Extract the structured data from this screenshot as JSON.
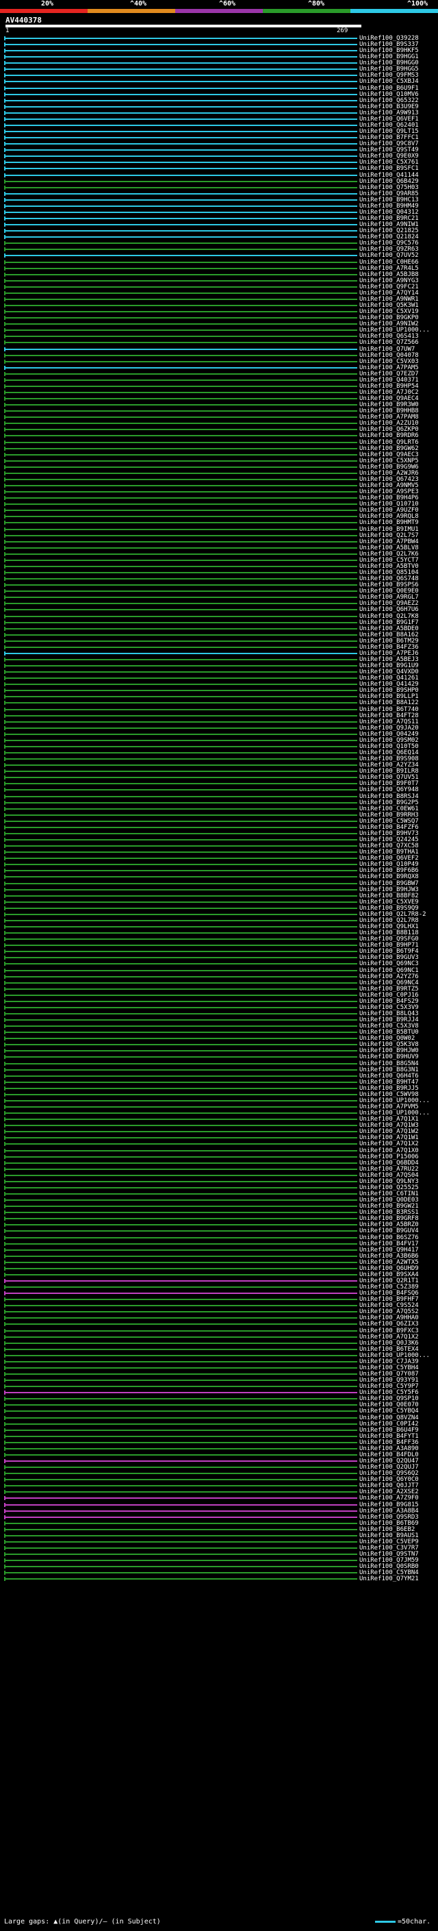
{
  "scale": {
    "labels": [
      "20%",
      "^40%",
      "^60%",
      "^80%",
      "^100%"
    ],
    "colors": [
      "#e52420",
      "#e08a1e",
      "#9a35a8",
      "#2a9b2a",
      "#2ec9e6"
    ]
  },
  "query": {
    "id": "AV440378",
    "start": "1",
    "end": "269"
  },
  "hit_colors": {
    "cyan": "#2ec9e6",
    "green": "#2a9b2a",
    "magenta": "#c040c0"
  },
  "hits": [
    {
      "id": "UniRef100_Q39228",
      "c": "cyan"
    },
    {
      "id": "UniRef100_B9S337",
      "c": "cyan"
    },
    {
      "id": "UniRef100_B9HKF5",
      "c": "cyan"
    },
    {
      "id": "UniRef100_B9HGG1",
      "c": "cyan"
    },
    {
      "id": "UniRef100_B9HGG0",
      "c": "cyan"
    },
    {
      "id": "UniRef100_B9HGG5",
      "c": "cyan"
    },
    {
      "id": "UniRef100_Q9FMS3",
      "c": "cyan"
    },
    {
      "id": "UniRef100_C5XBJ4",
      "c": "cyan"
    },
    {
      "id": "UniRef100_B6U9F1",
      "c": "cyan"
    },
    {
      "id": "UniRef100_Q10MV6",
      "c": "cyan"
    },
    {
      "id": "UniRef100_Q65322",
      "c": "cyan"
    },
    {
      "id": "UniRef100_B3U9E9",
      "c": "cyan"
    },
    {
      "id": "UniRef100_A9W913",
      "c": "cyan"
    },
    {
      "id": "UniRef100_Q6VEF1",
      "c": "cyan"
    },
    {
      "id": "UniRef100_Q62401",
      "c": "cyan"
    },
    {
      "id": "UniRef100_Q9LT15",
      "c": "cyan"
    },
    {
      "id": "UniRef100_B7FFC1",
      "c": "cyan"
    },
    {
      "id": "UniRef100_Q9C8V7",
      "c": "cyan"
    },
    {
      "id": "UniRef100_Q9ST49",
      "c": "cyan"
    },
    {
      "id": "UniRef100_Q9E0X9",
      "c": "cyan"
    },
    {
      "id": "UniRef100_C5X761",
      "c": "cyan"
    },
    {
      "id": "UniRef100_B9SFC1",
      "c": "cyan"
    },
    {
      "id": "UniRef100_Q41144",
      "c": "cyan"
    },
    {
      "id": "UniRef100_Q6B429",
      "c": "green"
    },
    {
      "id": "UniRef100_Q75H03",
      "c": "green"
    },
    {
      "id": "UniRef100_Q9AR85",
      "c": "cyan"
    },
    {
      "id": "UniRef100_B9HC13",
      "c": "cyan"
    },
    {
      "id": "UniRef100_B9HM49",
      "c": "cyan"
    },
    {
      "id": "UniRef100_Q04312",
      "c": "cyan"
    },
    {
      "id": "UniRef100_B9RC21",
      "c": "cyan"
    },
    {
      "id": "UniRef100_A9NIW1",
      "c": "cyan"
    },
    {
      "id": "UniRef100_Q21825",
      "c": "cyan"
    },
    {
      "id": "UniRef100_Q21824",
      "c": "cyan"
    },
    {
      "id": "UniRef100_Q9C576",
      "c": "green"
    },
    {
      "id": "UniRef100_Q9ZR63",
      "c": "green"
    },
    {
      "id": "UniRef100_Q7UV52",
      "c": "cyan"
    },
    {
      "id": "UniRef100_C0HE66",
      "c": "green"
    },
    {
      "id": "UniRef100_A7R4L5",
      "c": "green"
    },
    {
      "id": "UniRef100_A5BJB8",
      "c": "green"
    },
    {
      "id": "UniRef100_A9NYG3",
      "c": "green"
    },
    {
      "id": "UniRef100_Q9FC21",
      "c": "green"
    },
    {
      "id": "UniRef100_A7QY14",
      "c": "green"
    },
    {
      "id": "UniRef100_A9NWR1",
      "c": "green"
    },
    {
      "id": "UniRef100_Q5K3W1",
      "c": "green"
    },
    {
      "id": "UniRef100_C5XV19",
      "c": "green"
    },
    {
      "id": "UniRef100_B9GKP0",
      "c": "green"
    },
    {
      "id": "UniRef100_A9NIW2",
      "c": "green"
    },
    {
      "id": "UniRef100_UP1000...",
      "c": "green"
    },
    {
      "id": "UniRef100_Q6S413",
      "c": "green"
    },
    {
      "id": "UniRef100_Q7Z566",
      "c": "green"
    },
    {
      "id": "UniRef100_Q7UW7",
      "c": "cyan"
    },
    {
      "id": "UniRef100_Q04078",
      "c": "green"
    },
    {
      "id": "UniRef100_C5VX03",
      "c": "green"
    },
    {
      "id": "UniRef100_A7PAM5",
      "c": "cyan"
    },
    {
      "id": "UniRef100_Q7EZD7",
      "c": "green"
    },
    {
      "id": "UniRef100_Q40371",
      "c": "green"
    },
    {
      "id": "UniRef100_B9HP54",
      "c": "green"
    },
    {
      "id": "UniRef100_A7J0C2",
      "c": "green"
    },
    {
      "id": "UniRef100_Q9AEC4",
      "c": "green"
    },
    {
      "id": "UniRef100_B9R3W0",
      "c": "green"
    },
    {
      "id": "UniRef100_B9HHB8",
      "c": "green"
    },
    {
      "id": "UniRef100_A7PAM8",
      "c": "green"
    },
    {
      "id": "UniRef100_A2ZU10",
      "c": "green"
    },
    {
      "id": "UniRef100_Q6ZKP0",
      "c": "green"
    },
    {
      "id": "UniRef100_B9RDR6",
      "c": "green"
    },
    {
      "id": "UniRef100_Q9LRT6",
      "c": "green"
    },
    {
      "id": "UniRef100_B9GW62",
      "c": "green"
    },
    {
      "id": "UniRef100_Q9AEC3",
      "c": "green"
    },
    {
      "id": "UniRef100_C5XNP5",
      "c": "green"
    },
    {
      "id": "UniRef100_B9G9W6",
      "c": "green"
    },
    {
      "id": "UniRef100_A2WJR6",
      "c": "green"
    },
    {
      "id": "UniRef100_Q67423",
      "c": "green"
    },
    {
      "id": "UniRef100_A9NMV5",
      "c": "green"
    },
    {
      "id": "UniRef100_A9SPE3",
      "c": "green"
    },
    {
      "id": "UniRef100_B9H4P6",
      "c": "green"
    },
    {
      "id": "UniRef100_Q10710",
      "c": "green"
    },
    {
      "id": "UniRef100_A9UZF0",
      "c": "green"
    },
    {
      "id": "UniRef100_A9RQL8",
      "c": "green"
    },
    {
      "id": "UniRef100_B9HMT9",
      "c": "green"
    },
    {
      "id": "UniRef100_B9IMU1",
      "c": "green"
    },
    {
      "id": "UniRef100_Q2L7S7",
      "c": "green"
    },
    {
      "id": "UniRef100_A7PBW4",
      "c": "green"
    },
    {
      "id": "UniRef100_A5BLV8",
      "c": "green"
    },
    {
      "id": "UniRef100_Q2L7K6",
      "c": "green"
    },
    {
      "id": "UniRef100_C5YCT7",
      "c": "green"
    },
    {
      "id": "UniRef100_A5BTV0",
      "c": "green"
    },
    {
      "id": "UniRef100_Q85104",
      "c": "green"
    },
    {
      "id": "UniRef100_Q6S748",
      "c": "green"
    },
    {
      "id": "UniRef100_B9SPS6",
      "c": "green"
    },
    {
      "id": "UniRef100_Q0E9E0",
      "c": "green"
    },
    {
      "id": "UniRef100_A9RGL7",
      "c": "green"
    },
    {
      "id": "UniRef100_Q9AEZ2",
      "c": "green"
    },
    {
      "id": "UniRef100_Q6H7U6",
      "c": "green"
    },
    {
      "id": "UniRef100_Q2L7K8",
      "c": "green"
    },
    {
      "id": "UniRef100_B9G1F7",
      "c": "green"
    },
    {
      "id": "UniRef100_A5BDE0",
      "c": "green"
    },
    {
      "id": "UniRef100_B8A162",
      "c": "green"
    },
    {
      "id": "UniRef100_B6TM29",
      "c": "green"
    },
    {
      "id": "UniRef100_B4FZ36",
      "c": "green"
    },
    {
      "id": "UniRef100_A7PEJ6",
      "c": "cyan"
    },
    {
      "id": "UniRef100_A5BEJ3",
      "c": "green"
    },
    {
      "id": "UniRef100_B9G1U9",
      "c": "green"
    },
    {
      "id": "UniRef100_Q4VXD0",
      "c": "green"
    },
    {
      "id": "UniRef100_Q41261",
      "c": "green"
    },
    {
      "id": "UniRef100_Q41429",
      "c": "green"
    },
    {
      "id": "UniRef100_B9SHP0",
      "c": "green"
    },
    {
      "id": "UniRef100_B9LLP1",
      "c": "green"
    },
    {
      "id": "UniRef100_B8A122",
      "c": "green"
    },
    {
      "id": "UniRef100_B6T740",
      "c": "green"
    },
    {
      "id": "UniRef100_B4FT28",
      "c": "green"
    },
    {
      "id": "UniRef100_A7QS11",
      "c": "green"
    },
    {
      "id": "UniRef100_Q9JA20",
      "c": "green"
    },
    {
      "id": "UniRef100_Q04249",
      "c": "green"
    },
    {
      "id": "UniRef100_Q9SM02",
      "c": "green"
    },
    {
      "id": "UniRef100_Q10T50",
      "c": "green"
    },
    {
      "id": "UniRef100_Q6EQ14",
      "c": "green"
    },
    {
      "id": "UniRef100_B9S908",
      "c": "green"
    },
    {
      "id": "UniRef100_A2YZ34",
      "c": "green"
    },
    {
      "id": "UniRef100_B9ILR8",
      "c": "green"
    },
    {
      "id": "UniRef100_Q7UV51",
      "c": "green"
    },
    {
      "id": "UniRef100_B9F0T7",
      "c": "green"
    },
    {
      "id": "UniRef100_Q6Y948",
      "c": "green"
    },
    {
      "id": "UniRef100_B8RSJ4",
      "c": "green"
    },
    {
      "id": "UniRef100_B9G2P5",
      "c": "green"
    },
    {
      "id": "UniRef100_C0EW61",
      "c": "green"
    },
    {
      "id": "UniRef100_B9RRH3",
      "c": "green"
    },
    {
      "id": "UniRef100_C5WSQ7",
      "c": "green"
    },
    {
      "id": "UniRef100_B4FZF6",
      "c": "green"
    },
    {
      "id": "UniRef100_B9HV73",
      "c": "green"
    },
    {
      "id": "UniRef100_Q24245",
      "c": "green"
    },
    {
      "id": "UniRef100_Q7XC58",
      "c": "green"
    },
    {
      "id": "UniRef100_B9THA1",
      "c": "green"
    },
    {
      "id": "UniRef100_Q6VEF2",
      "c": "green"
    },
    {
      "id": "UniRef100_Q10P49",
      "c": "green"
    },
    {
      "id": "UniRef100_B9F6B6",
      "c": "green"
    },
    {
      "id": "UniRef100_B9RQX8",
      "c": "green"
    },
    {
      "id": "UniRef100_B9GBW7",
      "c": "green"
    },
    {
      "id": "UniRef100_B9HJW3",
      "c": "green"
    },
    {
      "id": "UniRef100_B8BF82",
      "c": "green"
    },
    {
      "id": "UniRef100_C5XVE9",
      "c": "green"
    },
    {
      "id": "UniRef100_B9S9Q9",
      "c": "green"
    },
    {
      "id": "UniRef100_Q2L7R8-2",
      "c": "green"
    },
    {
      "id": "UniRef100_Q2L7R8",
      "c": "green"
    },
    {
      "id": "UniRef100_Q9LHX1",
      "c": "green"
    },
    {
      "id": "UniRef100_B8B118",
      "c": "green"
    },
    {
      "id": "UniRef100_Q9SFG0",
      "c": "green"
    },
    {
      "id": "UniRef100_B9HP71",
      "c": "green"
    },
    {
      "id": "UniRef100_B6T9F4",
      "c": "green"
    },
    {
      "id": "UniRef100_B9GUV3",
      "c": "green"
    },
    {
      "id": "UniRef100_Q69NC3",
      "c": "green"
    },
    {
      "id": "UniRef100_Q69NC1",
      "c": "green"
    },
    {
      "id": "UniRef100_A2YZ76",
      "c": "green"
    },
    {
      "id": "UniRef100_Q69NC4",
      "c": "green"
    },
    {
      "id": "UniRef100_B9RTZ5",
      "c": "green"
    },
    {
      "id": "UniRef100_C0PJ16",
      "c": "green"
    },
    {
      "id": "UniRef100_B4FS29",
      "c": "green"
    },
    {
      "id": "UniRef100_C5X3V9",
      "c": "green"
    },
    {
      "id": "UniRef100_B8LQ43",
      "c": "green"
    },
    {
      "id": "UniRef100_B9RJJ4",
      "c": "green"
    },
    {
      "id": "UniRef100_C5X3V8",
      "c": "green"
    },
    {
      "id": "UniRef100_B5BTU0",
      "c": "green"
    },
    {
      "id": "UniRef100_Q0W02",
      "c": "green"
    },
    {
      "id": "UniRef100_Q5K3V8",
      "c": "green"
    },
    {
      "id": "UniRef100_B9HJW0",
      "c": "green"
    },
    {
      "id": "UniRef100_B9HUV9",
      "c": "green"
    },
    {
      "id": "UniRef100_B8G5N4",
      "c": "green"
    },
    {
      "id": "UniRef100_B8G3N1",
      "c": "green"
    },
    {
      "id": "UniRef100_Q6H4T6",
      "c": "green"
    },
    {
      "id": "UniRef100_B9HT47",
      "c": "green"
    },
    {
      "id": "UniRef100_B9RJJ5",
      "c": "green"
    },
    {
      "id": "UniRef100_C5WV98",
      "c": "green"
    },
    {
      "id": "UniRef100_UP1000...",
      "c": "green"
    },
    {
      "id": "UniRef100_A7PVM5",
      "c": "green"
    },
    {
      "id": "UniRef100_UP1000...",
      "c": "green"
    },
    {
      "id": "UniRef100_A7Q1X1",
      "c": "green"
    },
    {
      "id": "UniRef100_A7Q1W3",
      "c": "green"
    },
    {
      "id": "UniRef100_A7Q1W2",
      "c": "green"
    },
    {
      "id": "UniRef100_A7Q1W1",
      "c": "green"
    },
    {
      "id": "UniRef100_A7Q1X2",
      "c": "green"
    },
    {
      "id": "UniRef100_A7Q1X0",
      "c": "green"
    },
    {
      "id": "UniRef100_P15006",
      "c": "green"
    },
    {
      "id": "UniRef100_Q6BDD4",
      "c": "green"
    },
    {
      "id": "UniRef100_A7RU22",
      "c": "green"
    },
    {
      "id": "UniRef100_A7QS04",
      "c": "green"
    },
    {
      "id": "UniRef100_Q9LNY3",
      "c": "green"
    },
    {
      "id": "UniRef100_Q25525",
      "c": "green"
    },
    {
      "id": "UniRef100_C6TIN1",
      "c": "green"
    },
    {
      "id": "UniRef100_Q0DE03",
      "c": "green"
    },
    {
      "id": "UniRef100_B9GW21",
      "c": "green"
    },
    {
      "id": "UniRef100_B3RSS1",
      "c": "green"
    },
    {
      "id": "UniRef100_B9GRF8",
      "c": "green"
    },
    {
      "id": "UniRef100_A5BRZ0",
      "c": "green"
    },
    {
      "id": "UniRef100_B9GUV4",
      "c": "green"
    },
    {
      "id": "UniRef100_B6SZ76",
      "c": "green"
    },
    {
      "id": "UniRef100_B4FV17",
      "c": "green"
    },
    {
      "id": "UniRef100_Q9H417",
      "c": "green"
    },
    {
      "id": "UniRef100_A3B6B6",
      "c": "green"
    },
    {
      "id": "UniRef100_A2WTX5",
      "c": "green"
    },
    {
      "id": "UniRef100_Q6UHD9",
      "c": "green"
    },
    {
      "id": "UniRef100_B9SXA4",
      "c": "green"
    },
    {
      "id": "UniRef100_Q2R1T1",
      "c": "magenta"
    },
    {
      "id": "UniRef100_C5Z389",
      "c": "green"
    },
    {
      "id": "UniRef100_B4FSQ6",
      "c": "magenta"
    },
    {
      "id": "UniRef100_B9FHF7",
      "c": "green"
    },
    {
      "id": "UniRef100_C9S524",
      "c": "green"
    },
    {
      "id": "UniRef100_A7Q5S2",
      "c": "green"
    },
    {
      "id": "UniRef100_A9HHA0",
      "c": "green"
    },
    {
      "id": "UniRef100_Q6ZIX3",
      "c": "green"
    },
    {
      "id": "UniRef100_B9FXC3",
      "c": "green"
    },
    {
      "id": "UniRef100_A7Q1X2",
      "c": "green"
    },
    {
      "id": "UniRef100_Q0J3K6",
      "c": "green"
    },
    {
      "id": "UniRef100_B6TEX4",
      "c": "green"
    },
    {
      "id": "UniRef100_UP1000...",
      "c": "green"
    },
    {
      "id": "UniRef100_C7JA39",
      "c": "green"
    },
    {
      "id": "UniRef100_C5YBH4",
      "c": "green"
    },
    {
      "id": "UniRef100_Q7Y087",
      "c": "green"
    },
    {
      "id": "UniRef100_Q93Y91",
      "c": "green"
    },
    {
      "id": "UniRef100_C5Y9P7",
      "c": "green"
    },
    {
      "id": "UniRef100_C5Y5F6",
      "c": "magenta"
    },
    {
      "id": "UniRef100_Q9SP10",
      "c": "green"
    },
    {
      "id": "UniRef100_Q0E070",
      "c": "green"
    },
    {
      "id": "UniRef100_C5YBQ4",
      "c": "green"
    },
    {
      "id": "UniRef100_Q8VZN4",
      "c": "green"
    },
    {
      "id": "UniRef100_C0PI42",
      "c": "green"
    },
    {
      "id": "UniRef100_B6U4F9",
      "c": "green"
    },
    {
      "id": "UniRef100_B4FYT1",
      "c": "green"
    },
    {
      "id": "UniRef100_B4FF36",
      "c": "green"
    },
    {
      "id": "UniRef100_A3A890",
      "c": "green"
    },
    {
      "id": "UniRef100_B4FDL0",
      "c": "green"
    },
    {
      "id": "UniRef100_Q2QU47",
      "c": "magenta"
    },
    {
      "id": "UniRef100_Q2QUJ7",
      "c": "green"
    },
    {
      "id": "UniRef100_Q9S6Q2",
      "c": "green"
    },
    {
      "id": "UniRef100_Q6Y0C0",
      "c": "green"
    },
    {
      "id": "UniRef100_Q0JJT7",
      "c": "green"
    },
    {
      "id": "UniRef100_A2XSE2",
      "c": "green"
    },
    {
      "id": "UniRef100_A7Z9F0",
      "c": "magenta"
    },
    {
      "id": "UniRef100_B9G815",
      "c": "magenta"
    },
    {
      "id": "UniRef100_A3A8B4",
      "c": "magenta"
    },
    {
      "id": "UniRef100_Q9SRD3",
      "c": "magenta"
    },
    {
      "id": "UniRef100_B6TB69",
      "c": "green"
    },
    {
      "id": "UniRef100_B6EB2",
      "c": "green"
    },
    {
      "id": "UniRef100_B9AUS1",
      "c": "green"
    },
    {
      "id": "UniRef100_C5VEP9",
      "c": "green"
    },
    {
      "id": "UniRef100_C3V7R7",
      "c": "green"
    },
    {
      "id": "UniRef100_Q9STN7",
      "c": "green"
    },
    {
      "id": "UniRef100_Q7JM59",
      "c": "green"
    },
    {
      "id": "UniRef100_Q0SRB0",
      "c": "green"
    },
    {
      "id": "UniRef100_C5YBN4",
      "c": "green"
    },
    {
      "id": "UniRef100_Q7YM21",
      "c": "green"
    }
  ],
  "legend": {
    "text": "Large gaps: ▲(in Query)/– (in Subject)",
    "scale_text": "=50char."
  }
}
